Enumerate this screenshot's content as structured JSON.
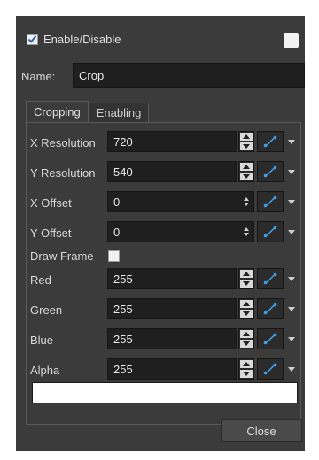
{
  "header": {
    "enable_label": "Enable/Disable",
    "enable_checked": true,
    "color_swatch": "#f2f2f2"
  },
  "name_row": {
    "label": "Name:",
    "value": "Crop"
  },
  "tabs": [
    {
      "label": "Cropping",
      "active": true
    },
    {
      "label": "Enabling",
      "active": false
    }
  ],
  "rows": [
    {
      "label": "X Resolution",
      "value": "720",
      "stepper": "large"
    },
    {
      "label": "Y Resolution",
      "value": "540",
      "stepper": "large"
    },
    {
      "label": "X Offset",
      "value": "0",
      "stepper": "small"
    },
    {
      "label": "Y Offset",
      "value": "0",
      "stepper": "small"
    }
  ],
  "draw_frame": {
    "label": "Draw Frame",
    "checked": false
  },
  "color_rows": [
    {
      "label": "Red",
      "value": "255"
    },
    {
      "label": "Green",
      "value": "255"
    },
    {
      "label": "Blue",
      "value": "255"
    },
    {
      "label": "Alpha",
      "value": "255"
    }
  ],
  "color_preview": "#ffffff",
  "footer": {
    "close_label": "Close"
  },
  "colors": {
    "panel_bg": "#3b3b3b",
    "field_bg": "#1f1f1f",
    "function_icon": "#3ea0e8"
  }
}
